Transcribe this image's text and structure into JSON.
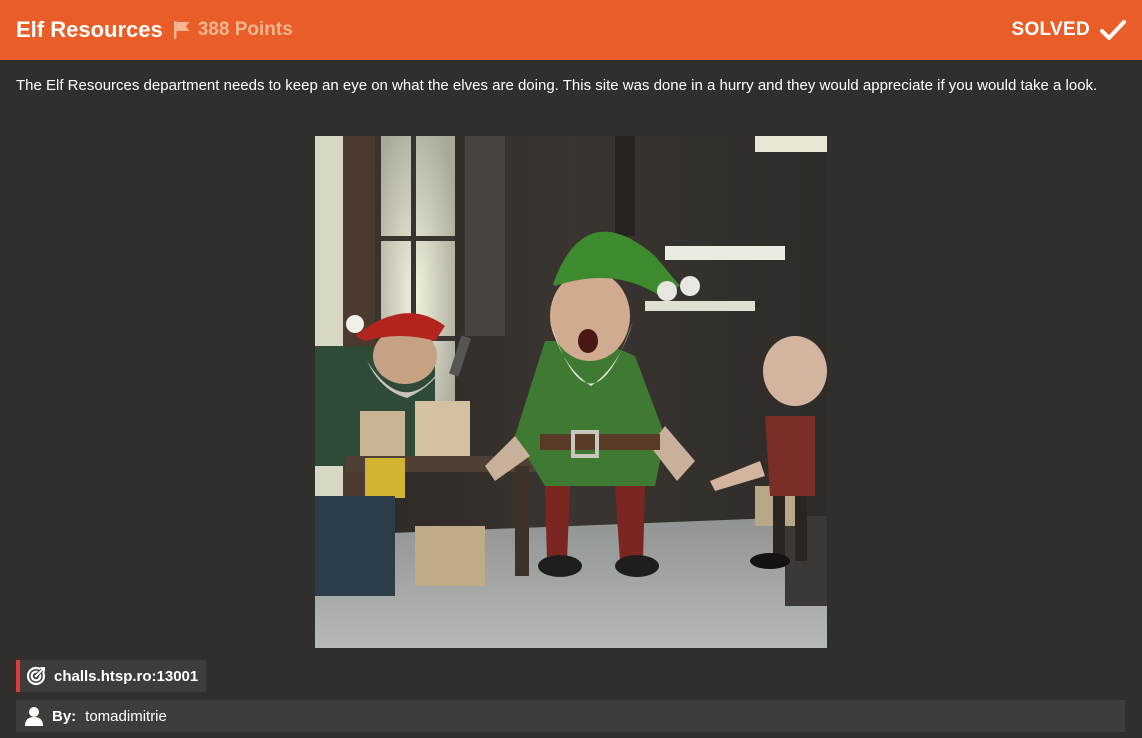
{
  "challenge": {
    "title": "Elf Resources",
    "points": "388 Points",
    "status": "SOLVED",
    "description": "The Elf Resources department needs to keep an eye on what the elves are doing. This site was done in a hurry and they would appreciate if you would take a look.",
    "connection": "challs.htsp.ro:13001",
    "author_label": "By:",
    "author": "tomadimitrie"
  },
  "icons": {
    "flag": "flag-icon",
    "check": "check-icon",
    "target": "target-icon",
    "user": "user-icon"
  },
  "colors": {
    "header_bg": "#e95e28",
    "page_bg": "#302f2c",
    "points_text": "#f6b48f",
    "connection_accent": "#e23a3a",
    "bar_bg": "#3f3d3a"
  }
}
